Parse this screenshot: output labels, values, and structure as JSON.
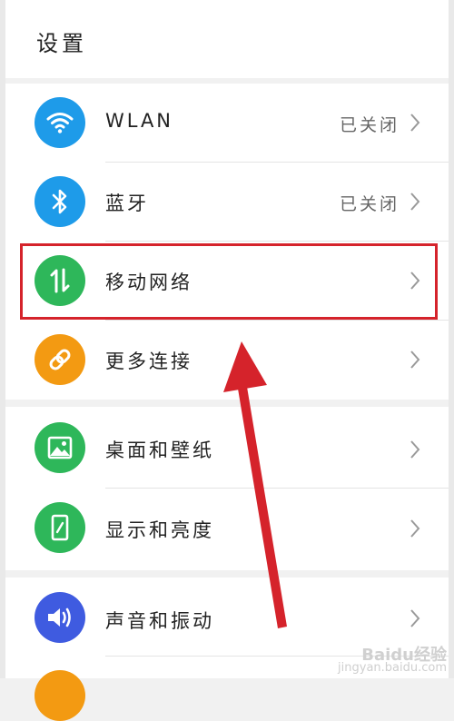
{
  "header": {
    "title": "设置"
  },
  "groups": [
    {
      "items": [
        {
          "label": "WLAN",
          "status": "已关闭",
          "icon": "wifi-icon",
          "color": "#1e9be9"
        },
        {
          "label": "蓝牙",
          "status": "已关闭",
          "icon": "bluetooth-icon",
          "color": "#1e9be9"
        },
        {
          "label": "移动网络",
          "status": "",
          "icon": "mobile-data-icon",
          "color": "#2eb75a"
        },
        {
          "label": "更多连接",
          "status": "",
          "icon": "link-icon",
          "color": "#f39a12"
        }
      ]
    },
    {
      "items": [
        {
          "label": "桌面和壁纸",
          "status": "",
          "icon": "wallpaper-icon",
          "color": "#2eb75a"
        },
        {
          "label": "显示和亮度",
          "status": "",
          "icon": "display-icon",
          "color": "#2eb75a"
        }
      ]
    },
    {
      "items": [
        {
          "label": "声音和振动",
          "status": "",
          "icon": "speaker-icon",
          "color": "#3f5be0"
        }
      ]
    }
  ],
  "annotation": {
    "highlight_color": "#d5232b",
    "arrow_color": "#d5232b"
  },
  "watermark": {
    "brand": "Baidu经验",
    "url": "jingyan.baidu.com"
  }
}
